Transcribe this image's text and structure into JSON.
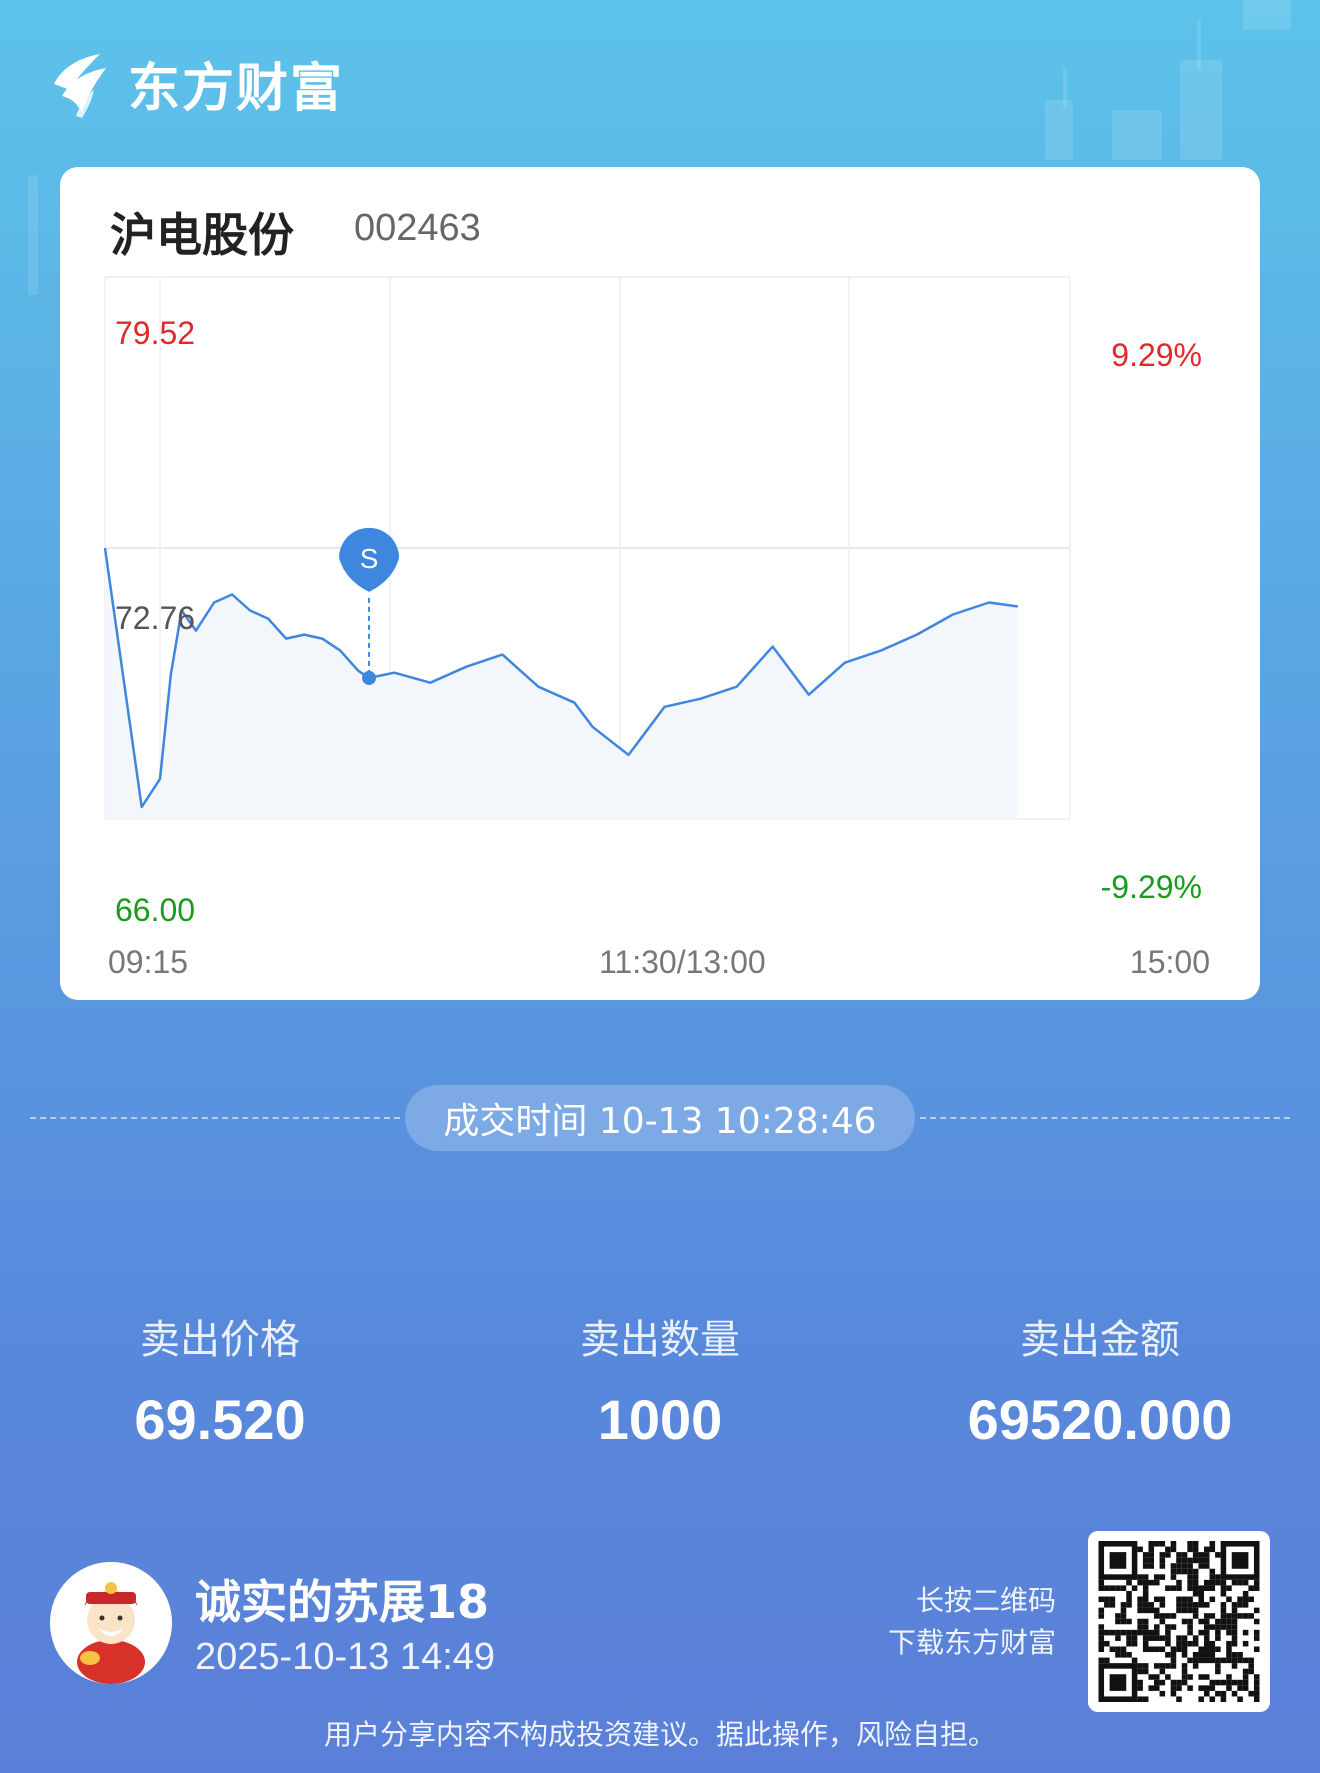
{
  "brand": {
    "name": "东方财富"
  },
  "stock": {
    "name": "沪电股份",
    "code": "002463"
  },
  "chart_data": {
    "type": "line",
    "title": "",
    "price_high_label": "79.52",
    "price_mid_label": "72.76",
    "price_low_label": "66.00",
    "pct_high_label": "9.29%",
    "pct_low_label": "-9.29%",
    "x_tick_labels": [
      "09:15",
      "11:30/13:00",
      "15:00"
    ],
    "ylim": [
      66.0,
      79.52
    ],
    "reference_price": 72.76,
    "marker": {
      "label": "S",
      "time": "10:28",
      "price": 69.52
    },
    "series": [
      {
        "x": [
          "09:15",
          "09:25",
          "09:30",
          "09:33",
          "09:36",
          "09:40",
          "09:45",
          "09:50",
          "09:55",
          "10:00",
          "10:05",
          "10:10",
          "10:15",
          "10:20",
          "10:25",
          "10:28",
          "10:35",
          "10:45",
          "10:55",
          "11:05",
          "11:15",
          "11:25",
          "11:30",
          "13:10",
          "13:20",
          "13:30",
          "13:40",
          "13:50",
          "14:00",
          "14:10",
          "14:20",
          "14:30",
          "14:40",
          "14:50",
          "14:58"
        ],
        "y": [
          72.76,
          66.3,
          67.0,
          69.6,
          71.2,
          70.7,
          71.4,
          71.6,
          71.2,
          71.0,
          70.5,
          70.6,
          70.5,
          70.2,
          69.7,
          69.52,
          69.65,
          69.4,
          69.8,
          70.1,
          69.3,
          68.9,
          68.3,
          67.6,
          68.8,
          69.0,
          69.3,
          70.3,
          69.1,
          69.9,
          70.2,
          70.6,
          71.1,
          71.4,
          71.3
        ]
      }
    ]
  },
  "trade": {
    "time_label": "成交时间 10-13 10:28:46"
  },
  "stats": [
    {
      "label": "卖出价格",
      "value": "69.520"
    },
    {
      "label": "卖出数量",
      "value": "1000"
    },
    {
      "label": "卖出金额",
      "value": "69520.000"
    }
  ],
  "user": {
    "name": "诚实的苏展18",
    "share_time": "2025-10-13 14:49",
    "avatar": "cartoon-fortune-god-avatar"
  },
  "qr": {
    "hint_line1": "长按二维码",
    "hint_line2": "下载东方财富"
  },
  "footer": {
    "disclaimer": "用户分享内容不构成投资建议。据此操作，风险自担。"
  },
  "colors": {
    "up": "#e02a2a",
    "down": "#1a9b1a",
    "line": "#3f86de",
    "fill": "#f3f7fc"
  }
}
